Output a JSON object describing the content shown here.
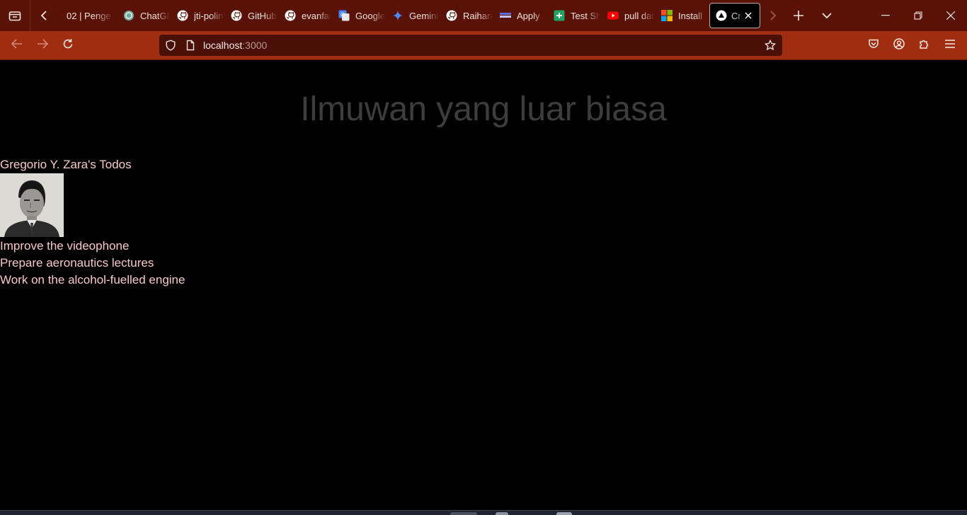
{
  "browser": {
    "tabs": [
      {
        "title": "02 | Penge",
        "icon": "doc-icon",
        "icon_color": "#f2e4de",
        "active": false
      },
      {
        "title": "ChatGPT",
        "icon": "chatgpt-icon",
        "icon_color": "#74aa9c",
        "active": false
      },
      {
        "title": "jti-polinema",
        "icon": "github-icon",
        "icon_color": "#ffffff",
        "active": false
      },
      {
        "title": "GitHub",
        "icon": "github-icon",
        "icon_color": "#ffffff",
        "active": false
      },
      {
        "title": "evanfadilah",
        "icon": "github-icon",
        "icon_color": "#ffffff",
        "active": false
      },
      {
        "title": "Google",
        "icon": "google-translate-icon",
        "icon_color": "#4285f4",
        "active": false
      },
      {
        "title": "Gemini",
        "icon": "gemini-icon",
        "icon_color": "#4a8af4",
        "active": false
      },
      {
        "title": "Raihan",
        "icon": "github-icon",
        "icon_color": "#ffffff",
        "active": false
      },
      {
        "title": "Apply",
        "icon": "apply-icon",
        "icon_color": "#5b6fd8",
        "active": false
      },
      {
        "title": "Test Sheet",
        "icon": "sheets-plus-icon",
        "icon_color": "#1fa463",
        "active": false
      },
      {
        "title": "pull data",
        "icon": "youtube-icon",
        "icon_color": "#ff0000",
        "active": false
      },
      {
        "title": "Install",
        "icon": "microsoft-icon",
        "icon_color": "#f25022",
        "active": false
      },
      {
        "title": "Create Next App",
        "icon": "nextjs-triangle-icon",
        "icon_color": "#ffffff",
        "active": true
      }
    ],
    "url": {
      "host": "localhost",
      "port": ":3000"
    },
    "colors": {
      "tabstrip": "#5a1207",
      "navbar": "#a02d10",
      "urlbar": "#4a0f07"
    }
  },
  "page": {
    "heading": "Ilmuwan yang luar biasa",
    "owner_title": "Gregorio Y. Zara's Todos",
    "portrait_alt": "Gregorio Y. Zara",
    "todos": [
      "Improve the videophone",
      "Prepare aeronautics lectures",
      "Work on the alcohol-fuelled engine"
    ],
    "colors": {
      "heading": "#3d3d3d",
      "text": "#f8c8c8",
      "background": "#000000"
    }
  }
}
